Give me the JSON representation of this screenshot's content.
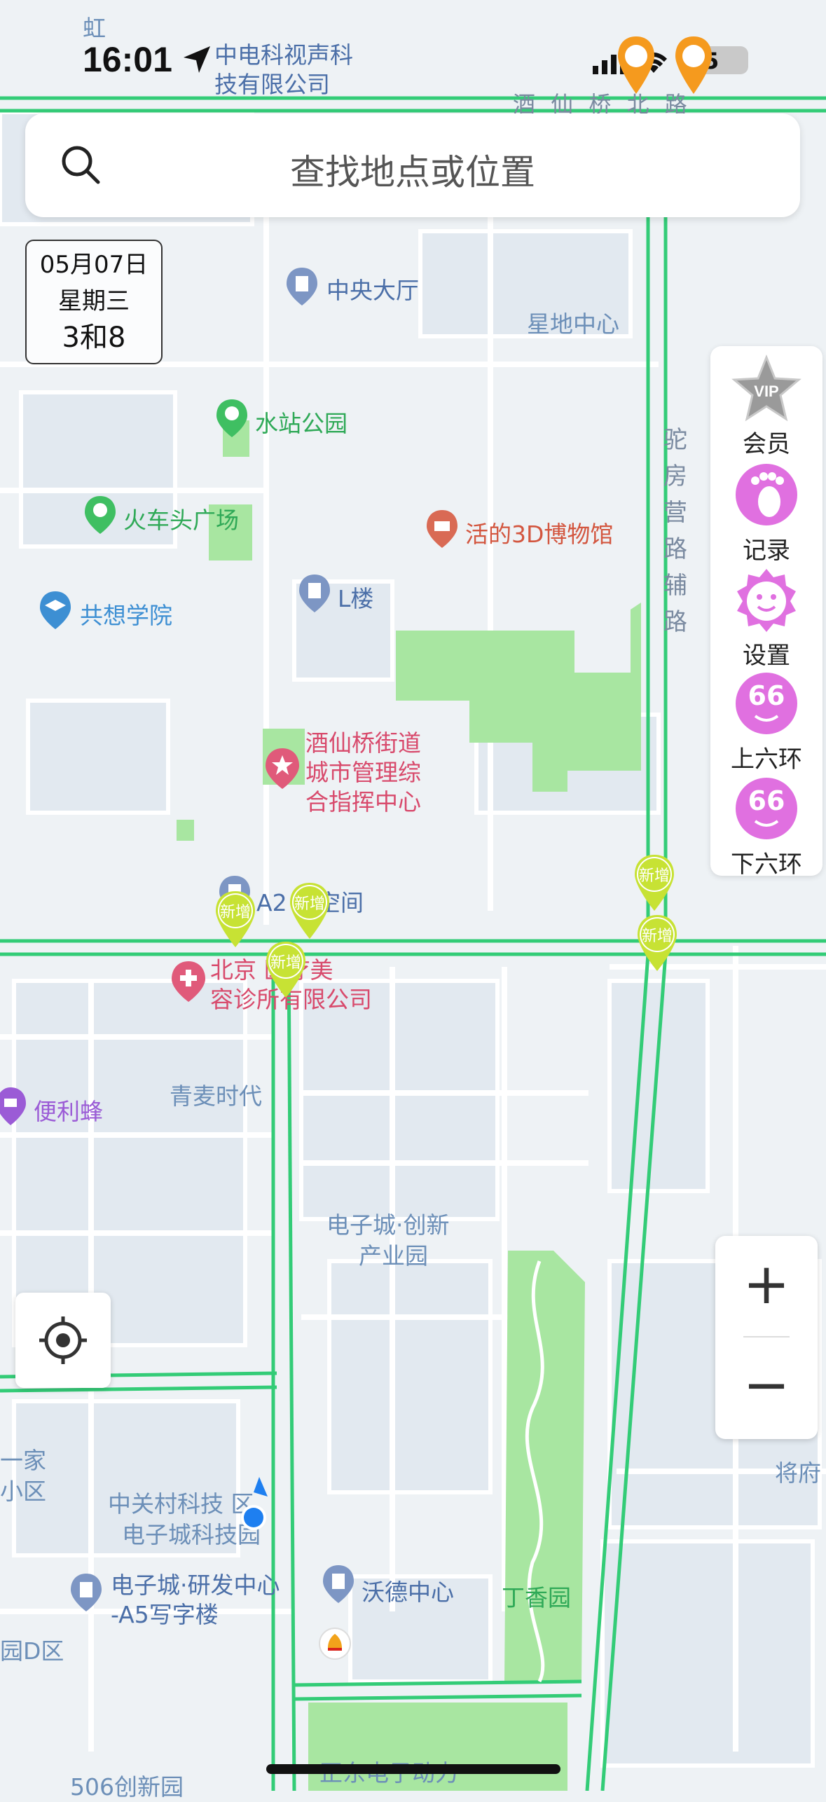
{
  "status_bar": {
    "time": "16:01",
    "battery": "5"
  },
  "search": {
    "placeholder": "查找地点或位置"
  },
  "date_box": {
    "date": "05月07日",
    "weekday": "星期三",
    "restriction": "3和8"
  },
  "toolbar": {
    "items": [
      {
        "label": "会员",
        "icon": "vip-star-icon",
        "badge": "VIP"
      },
      {
        "label": "记录",
        "icon": "footprint-icon"
      },
      {
        "label": "设置",
        "icon": "smiley-gear-icon"
      },
      {
        "label": "上六环",
        "icon": "ring-66-up-icon",
        "badge": "66"
      },
      {
        "label": "下六环",
        "icon": "ring-66-down-icon",
        "badge": "66"
      }
    ]
  },
  "zoom": {
    "in_label": "+",
    "out_label": "−"
  },
  "new_marker_label": "新增",
  "map_labels": {
    "road_top": "酒 仙 桥 北 路",
    "company_top_1": "中电科视声科",
    "company_top_2": "技有限公司",
    "hong": "虹",
    "central_hall": "中央大厅",
    "xingdi": "星地中心",
    "water_park": "水站公园",
    "train_square": "火车头广场",
    "museum": "活的3D博物馆",
    "l_building": "L楼",
    "gongxiang": "共想学院",
    "street_center_1": "酒仙桥街道",
    "street_center_2": "城市管理综",
    "street_center_3": "合指挥中心",
    "a2": "A2  术空间",
    "clinic_1": "北京   医疗美",
    "clinic_2": "容诊所有限公司",
    "qingmai": "青麦时代",
    "bianlifeng": "便利蜂",
    "etown_1": "电子城·创新",
    "etown_2": "产业园",
    "zgc_1": "中关村科技 区",
    "zgc_2": "电子城科技园",
    "rd_center_1": "电子城·研发中心",
    "rd_center_2": "-A5写字楼",
    "wode": "沃德中心",
    "dingxiang": "丁香园",
    "tuofang_road": [
      "驼",
      "房",
      "营",
      "路",
      "辅",
      "路"
    ],
    "jiangfu": "将府",
    "yijia_1": "一家",
    "yijia_2": "小区",
    "d_zone": "园D区",
    "bottom_1": "506创新园",
    "bottom_2": "正东电子动力"
  },
  "colors": {
    "road_green": "#2ecc71",
    "park_green": "#a8e6a1",
    "block_fill": "#e3eaf0",
    "location_blue": "#1e7ff0"
  }
}
